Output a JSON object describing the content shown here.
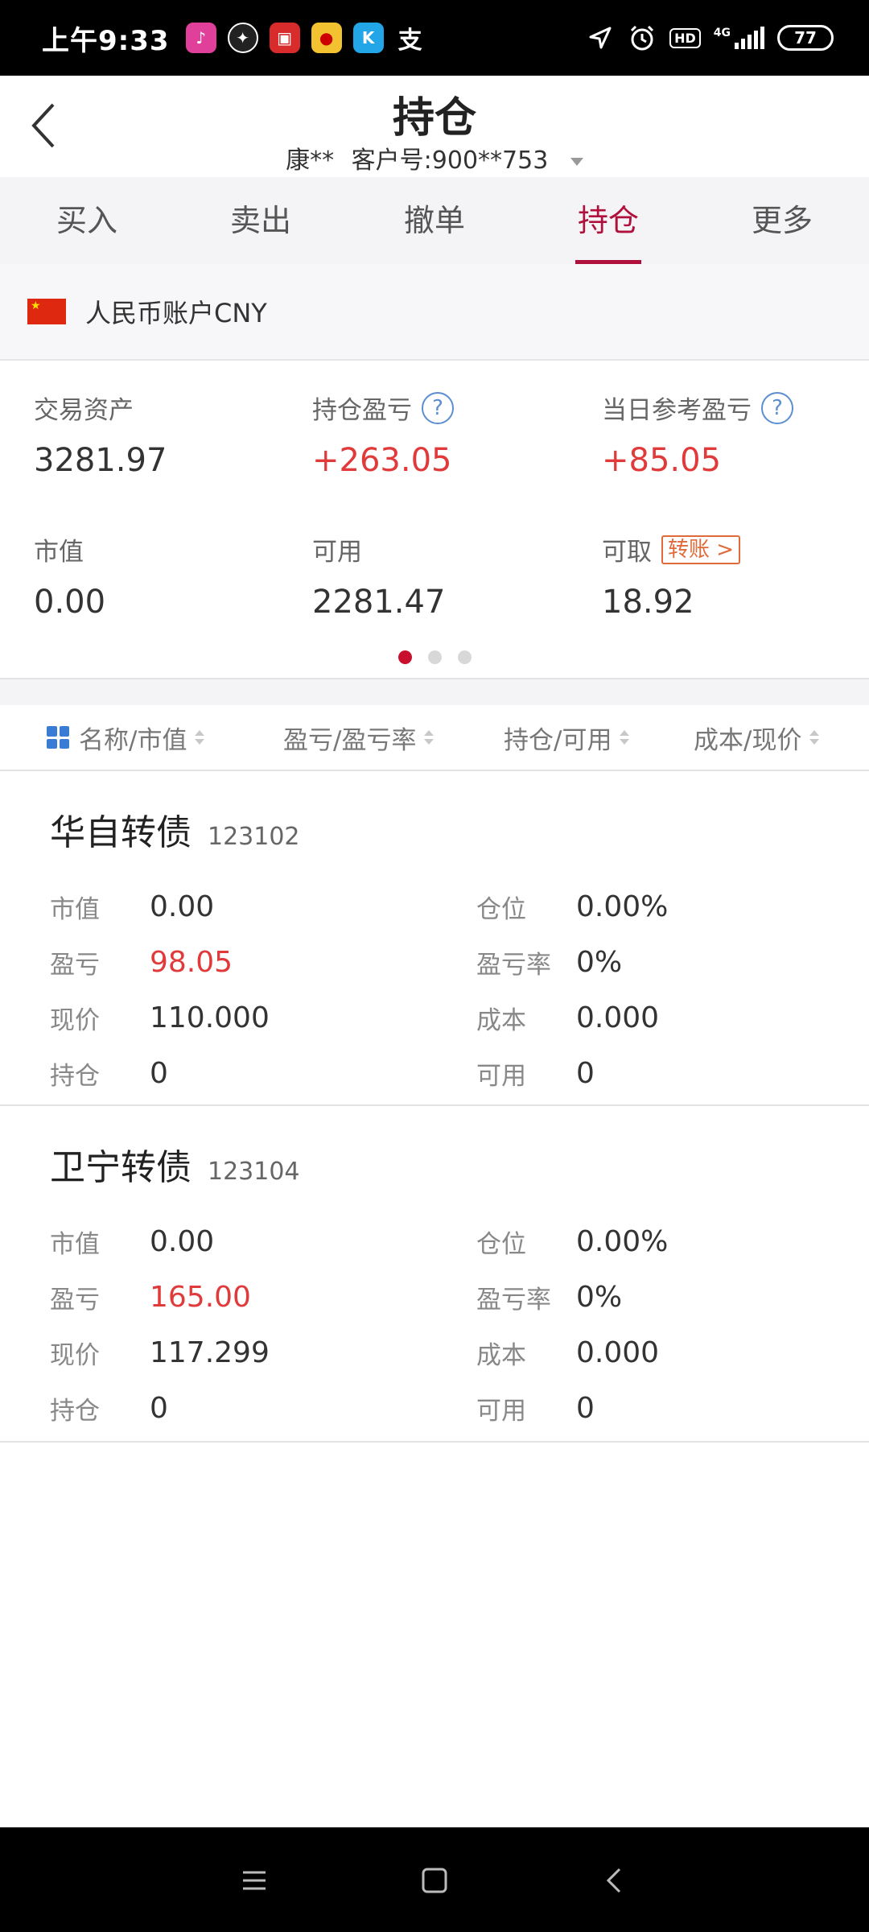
{
  "status_bar": {
    "time": "上午9:33",
    "network": "4G",
    "hd": "HD",
    "battery": "77",
    "app_icons": [
      "tiktok-icon",
      "app-icon-2",
      "app-icon-3",
      "app-icon-4",
      "kugou-icon",
      "alipay-icon"
    ]
  },
  "header": {
    "title": "持仓",
    "account_name": "康**",
    "customer_no": "客户号:900**753"
  },
  "tabs": [
    {
      "label": "买入",
      "active": false
    },
    {
      "label": "卖出",
      "active": false
    },
    {
      "label": "撤单",
      "active": false
    },
    {
      "label": "持仓",
      "active": true
    },
    {
      "label": "更多",
      "active": false
    }
  ],
  "account": {
    "label": "人民币账户CNY"
  },
  "summary": {
    "trade_assets_label": "交易资产",
    "trade_assets_value": "3281.97",
    "position_pnl_label": "持仓盈亏",
    "position_pnl_value": "+263.05",
    "daily_pnl_label": "当日参考盈亏",
    "daily_pnl_value": "+85.05",
    "market_value_label": "市值",
    "market_value_value": "0.00",
    "available_label": "可用",
    "available_value": "2281.47",
    "withdrawable_label": "可取",
    "withdrawable_value": "18.92",
    "transfer_label": "转账 >",
    "page_dots": 3,
    "active_dot": 0
  },
  "sort_bar": {
    "col1": "名称/市值",
    "col2": "盈亏/盈亏率",
    "col3": "持仓/可用",
    "col4": "成本/现价"
  },
  "positions": [
    {
      "name": "华自转债",
      "code": "123102",
      "market_value_label": "市值",
      "market_value": "0.00",
      "position_ratio_label": "仓位",
      "position_ratio": "0.00%",
      "pnl_label": "盈亏",
      "pnl": "98.05",
      "pnl_rate_label": "盈亏率",
      "pnl_rate": "0%",
      "price_label": "现价",
      "price": "110.000",
      "cost_label": "成本",
      "cost": "0.000",
      "holding_label": "持仓",
      "holding": "0",
      "avail_label": "可用",
      "avail": "0"
    },
    {
      "name": "卫宁转债",
      "code": "123104",
      "market_value_label": "市值",
      "market_value": "0.00",
      "position_ratio_label": "仓位",
      "position_ratio": "0.00%",
      "pnl_label": "盈亏",
      "pnl": "165.00",
      "pnl_rate_label": "盈亏率",
      "pnl_rate": "0%",
      "price_label": "现价",
      "price": "117.299",
      "cost_label": "成本",
      "cost": "0.000",
      "holding_label": "持仓",
      "holding": "0",
      "avail_label": "可用",
      "avail": "0"
    }
  ],
  "colors": {
    "accent": "#b0103c",
    "gain": "#e03a3a",
    "link": "#5b8fd0"
  }
}
